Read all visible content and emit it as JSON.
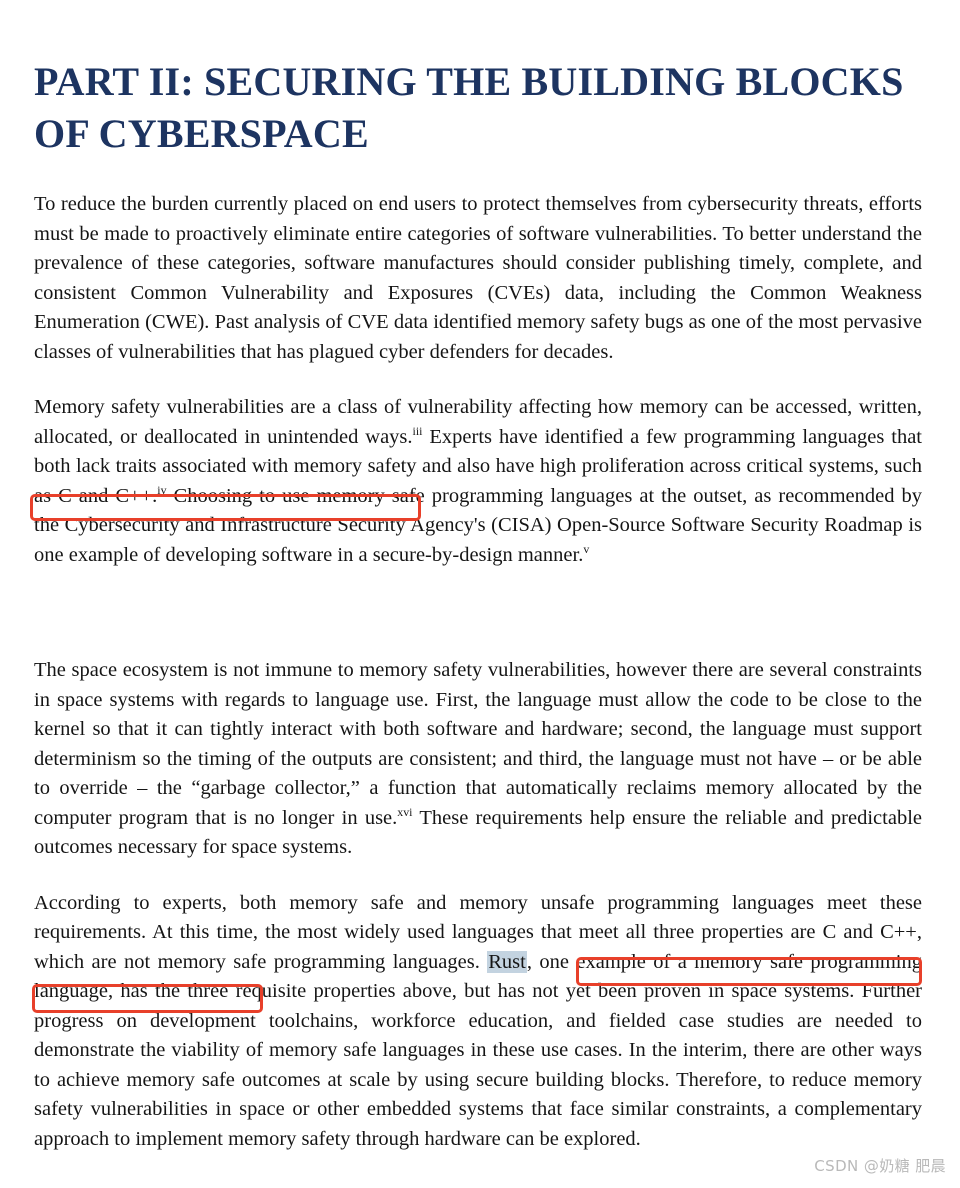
{
  "document": {
    "title": "PART II: SECURING THE BUILDING BLOCKS OF CYBERSPACE",
    "title_color": "#1d3461",
    "paragraphs": {
      "p1": "To reduce the burden currently placed on end users to protect themselves from cybersecurity threats, efforts must be made to proactively eliminate entire categories of software vulnerabilities. To better understand the prevalence of these categories, software manufactures should consider publishing timely, complete, and consistent Common Vulnerability and Exposures (CVEs) data, including the Common Weakness Enumeration (CWE). Past analysis of CVE data identified memory safety bugs as one of the most pervasive classes of vulnerabilities that has plagued cyber defenders for decades.",
      "p2_a": "Memory safety vulnerabilities are a class of vulnerability affecting how memory can be accessed, written, allocated, or deallocated in unintended ways.",
      "p2_sup1": "iii",
      "p2_b": " Experts have identified a few programming languages that both lack traits associated with memory safety and also have high proliferation across critical systems, such as C and C++.",
      "p2_sup2": "iv",
      "p2_c": " Choosing to use memory safe programming languages at the outset, as recommended by the Cybersecurity and Infrastructure Security Agency's (CISA) Open-Source Software Security Roadmap is one example of developing software in a secure-by-design manner.",
      "p2_sup3": "v",
      "p3_a": "The space ecosystem is not immune to memory safety vulnerabilities, however there are several constraints in space systems with regards to language use. First, the language must allow the code to be close to the kernel so that it can tightly interact with both software and hardware; second, the language must support determinism so the timing of the outputs are consistent; and third, the language must not have – or be able to override – the “garbage collector,” a function that automatically reclaims memory allocated by the computer program that is no longer in use.",
      "p3_sup1": "xvi",
      "p3_b": " These requirements help ensure the reliable and predictable outcomes necessary for space systems.",
      "p4_a": "According to experts, both memory safe and memory unsafe programming languages meet these requirements. At this time, the most widely used languages that meet all three properties are C and C++, which are not memory safe programming languages. ",
      "p4_highlight": "Rust",
      "p4_b": ", one example of a memory safe programming language, has the three requisite properties above, but has not yet been proven in space systems. Further progress on development toolchains, workforce education, and fielded case studies are needed to demonstrate the viability of memory safe languages in these use cases. In the interim, there are other ways to achieve memory safe outcomes at scale by using secure building blocks. Therefore, to reduce memory safety vulnerabilities in space or other embedded systems that face similar constraints, a complementary approach to implement memory safety through hardware can be explored."
    }
  },
  "annotations": {
    "box_color": "#e8402a",
    "selection_color": "#c3d3e0",
    "boxes": [
      {
        "id": "c-cpp",
        "phrase": "across critical systems, such as C and C++."
      },
      {
        "id": "rust-line1",
        "phrase": "Rust, one example of a memory safe"
      },
      {
        "id": "rust-line2",
        "phrase": "programming language,"
      }
    ]
  },
  "watermark": {
    "text": "CSDN @奶糖 肥晨"
  }
}
